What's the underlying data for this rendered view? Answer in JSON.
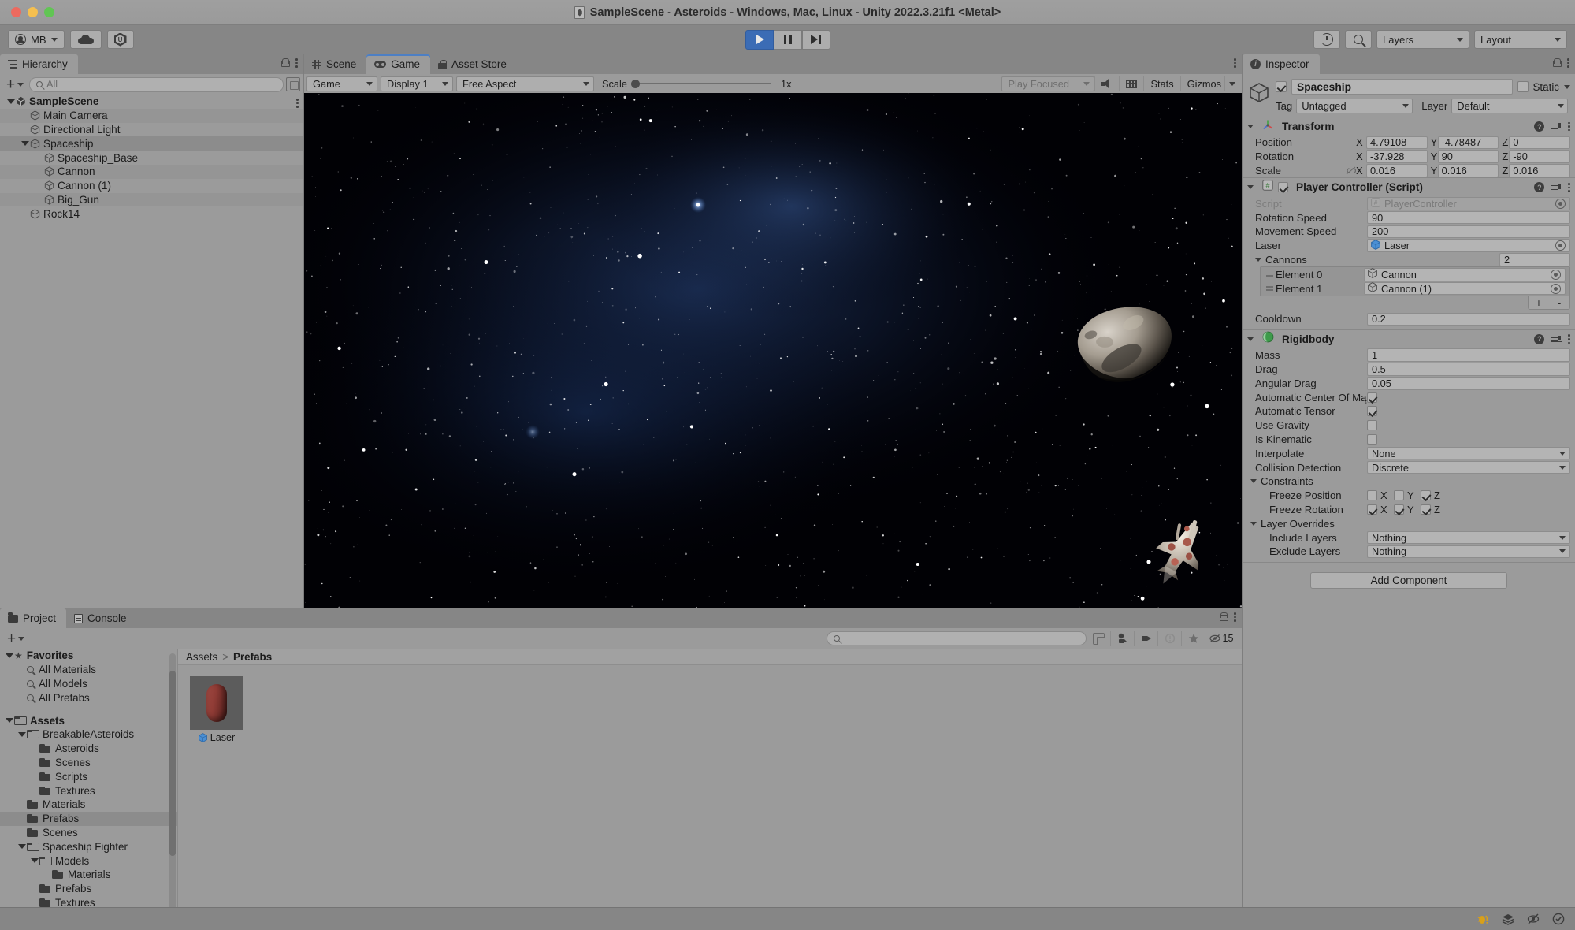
{
  "window": {
    "title": "SampleScene - Asteroids - Windows, Mac, Linux - Unity 2022.3.21f1 <Metal>"
  },
  "toolbar": {
    "account_label": "MB",
    "cloud_icon": "cloud-icon",
    "services_icon": "unity-services-icon",
    "play_icon": "play-icon",
    "pause_icon": "pause-icon",
    "step_icon": "step-icon",
    "play_active": true,
    "history_icon": "history-icon",
    "search_icon": "search-icon",
    "layers_label": "Layers",
    "layout_label": "Layout"
  },
  "hierarchy": {
    "tab_label": "Hierarchy",
    "add_label": "+",
    "search_placeholder": "All",
    "items": [
      {
        "label": "SampleScene",
        "depth": 0,
        "expanded": true,
        "selected": false,
        "bold": true,
        "icon": "unity-scene-icon"
      },
      {
        "label": "Main Camera",
        "depth": 1,
        "expanded": null,
        "selected": false,
        "bold": false,
        "icon": "gameobject-icon"
      },
      {
        "label": "Directional Light",
        "depth": 1,
        "expanded": null,
        "selected": false,
        "bold": false,
        "icon": "gameobject-icon"
      },
      {
        "label": "Spaceship",
        "depth": 1,
        "expanded": true,
        "selected": true,
        "bold": false,
        "icon": "gameobject-icon"
      },
      {
        "label": "Spaceship_Base",
        "depth": 2,
        "expanded": null,
        "selected": false,
        "bold": false,
        "icon": "gameobject-icon"
      },
      {
        "label": "Cannon",
        "depth": 2,
        "expanded": null,
        "selected": false,
        "bold": false,
        "icon": "gameobject-icon"
      },
      {
        "label": "Cannon (1)",
        "depth": 2,
        "expanded": null,
        "selected": false,
        "bold": false,
        "icon": "gameobject-icon"
      },
      {
        "label": "Big_Gun",
        "depth": 2,
        "expanded": null,
        "selected": false,
        "bold": false,
        "icon": "gameobject-icon"
      },
      {
        "label": "Rock14",
        "depth": 1,
        "expanded": null,
        "selected": false,
        "bold": false,
        "icon": "gameobject-icon"
      }
    ]
  },
  "center_tabs": [
    {
      "label": "Scene",
      "icon": "scene-icon",
      "selected": false
    },
    {
      "label": "Game",
      "icon": "game-icon",
      "selected": true
    },
    {
      "label": "Asset Store",
      "icon": "asset-store-icon",
      "selected": false
    }
  ],
  "gameview": {
    "view_select": "Game",
    "display_select": "Display 1",
    "aspect_select": "Free Aspect",
    "scale_label": "Scale",
    "scale_value": "1x",
    "play_focus_select": "Play Focused",
    "mute_icon": "mute-audio-icon",
    "stats_icon": "frame-debug-icon",
    "stats_label": "Stats",
    "gizmos_label": "Gizmos"
  },
  "inspector": {
    "tab_label": "Inspector",
    "object_name": "Spaceship",
    "enabled": true,
    "static_label": "Static",
    "static_checked": false,
    "tag_label": "Tag",
    "tag_value": "Untagged",
    "layer_label": "Layer",
    "layer_value": "Default",
    "transform": {
      "title": "Transform",
      "rows": [
        {
          "label": "Position",
          "x": "4.79108",
          "y": "-4.78487",
          "z": "0"
        },
        {
          "label": "Rotation",
          "x": "-37.928",
          "y": "90",
          "z": "-90"
        },
        {
          "label": "Scale",
          "x": "0.016",
          "y": "0.016",
          "z": "0.016"
        }
      ]
    },
    "player_controller": {
      "title": "Player Controller (Script)",
      "enabled": true,
      "script_label": "Script",
      "script_value": "PlayerController",
      "rotation_speed_label": "Rotation Speed",
      "rotation_speed_value": "90",
      "movement_speed_label": "Movement Speed",
      "movement_speed_value": "200",
      "laser_label": "Laser",
      "laser_value": "Laser",
      "cannons_label": "Cannons",
      "cannons_count": "2",
      "cannons": [
        {
          "label": "Element 0",
          "value": "Cannon"
        },
        {
          "label": "Element 1",
          "value": "Cannon (1)"
        }
      ],
      "add_btn": "+",
      "remove_btn": "-",
      "cooldown_label": "Cooldown",
      "cooldown_value": "0.2"
    },
    "rigidbody": {
      "title": "Rigidbody",
      "mass_label": "Mass",
      "mass_value": "1",
      "drag_label": "Drag",
      "drag_value": "0.5",
      "angular_drag_label": "Angular Drag",
      "angular_drag_value": "0.05",
      "auto_com_label": "Automatic Center Of Mą",
      "auto_com_checked": true,
      "auto_tensor_label": "Automatic Tensor",
      "auto_tensor_checked": true,
      "use_gravity_label": "Use Gravity",
      "use_gravity_checked": false,
      "is_kinematic_label": "Is Kinematic",
      "is_kinematic_checked": false,
      "interpolate_label": "Interpolate",
      "interpolate_value": "None",
      "collision_label": "Collision Detection",
      "collision_value": "Discrete",
      "constraints_label": "Constraints",
      "freeze_position_label": "Freeze Position",
      "freeze_position": {
        "x": false,
        "y": false,
        "z": true
      },
      "freeze_rotation_label": "Freeze Rotation",
      "freeze_rotation": {
        "x": true,
        "y": true,
        "z": true
      },
      "layer_overrides_label": "Layer Overrides",
      "include_layers_label": "Include Layers",
      "include_layers_value": "Nothing",
      "exclude_layers_label": "Exclude Layers",
      "exclude_layers_value": "Nothing"
    },
    "add_component_label": "Add Component",
    "axis_x": "X",
    "axis_y": "Y",
    "axis_z": "Z"
  },
  "project": {
    "tabs": [
      {
        "label": "Project",
        "icon": "folder-icon",
        "selected": true
      },
      {
        "label": "Console",
        "icon": "console-icon",
        "selected": false
      }
    ],
    "add_label": "+",
    "search_placeholder": "",
    "hidden_count": "15",
    "tree": [
      {
        "label": "Favorites",
        "depth": 0,
        "kind": "star",
        "expanded": true,
        "bold": true,
        "selected": false
      },
      {
        "label": "All Materials",
        "depth": 1,
        "kind": "search",
        "expanded": null,
        "bold": false,
        "selected": false
      },
      {
        "label": "All Models",
        "depth": 1,
        "kind": "search",
        "expanded": null,
        "bold": false,
        "selected": false
      },
      {
        "label": "All Prefabs",
        "depth": 1,
        "kind": "search",
        "expanded": null,
        "bold": false,
        "selected": false
      },
      {
        "label": "",
        "depth": 0,
        "kind": "spacer",
        "expanded": null,
        "bold": false,
        "selected": false
      },
      {
        "label": "Assets",
        "depth": 0,
        "kind": "folder-open",
        "expanded": true,
        "bold": true,
        "selected": false
      },
      {
        "label": "BreakableAsteroids",
        "depth": 1,
        "kind": "folder-open",
        "expanded": true,
        "bold": false,
        "selected": false
      },
      {
        "label": "Asteroids",
        "depth": 2,
        "kind": "folder",
        "expanded": null,
        "bold": false,
        "selected": false
      },
      {
        "label": "Scenes",
        "depth": 2,
        "kind": "folder",
        "expanded": null,
        "bold": false,
        "selected": false
      },
      {
        "label": "Scripts",
        "depth": 2,
        "kind": "folder",
        "expanded": null,
        "bold": false,
        "selected": false
      },
      {
        "label": "Textures",
        "depth": 2,
        "kind": "folder",
        "expanded": null,
        "bold": false,
        "selected": false
      },
      {
        "label": "Materials",
        "depth": 1,
        "kind": "folder",
        "expanded": null,
        "bold": false,
        "selected": false
      },
      {
        "label": "Prefabs",
        "depth": 1,
        "kind": "folder",
        "expanded": null,
        "bold": false,
        "selected": true
      },
      {
        "label": "Scenes",
        "depth": 1,
        "kind": "folder",
        "expanded": null,
        "bold": false,
        "selected": false
      },
      {
        "label": "Spaceship Fighter",
        "depth": 1,
        "kind": "folder-open",
        "expanded": true,
        "bold": false,
        "selected": false
      },
      {
        "label": "Models",
        "depth": 2,
        "kind": "folder-open",
        "expanded": true,
        "bold": false,
        "selected": false
      },
      {
        "label": "Materials",
        "depth": 3,
        "kind": "folder",
        "expanded": null,
        "bold": false,
        "selected": false
      },
      {
        "label": "Prefabs",
        "depth": 2,
        "kind": "folder",
        "expanded": null,
        "bold": false,
        "selected": false
      },
      {
        "label": "Textures",
        "depth": 2,
        "kind": "folder",
        "expanded": null,
        "bold": false,
        "selected": false
      }
    ],
    "breadcrumbs": [
      "Assets",
      "Prefabs"
    ],
    "assets": [
      {
        "name": "Laser",
        "type": "prefab"
      }
    ]
  },
  "statusbar": {
    "icons": [
      "bug-warning-icon",
      "layers-stack-icon",
      "no-collab-icon",
      "check-circle-icon"
    ]
  },
  "colors": {
    "accent_blue": "#3b6cb5",
    "panel_bg": "#9b9b9b",
    "toolbar_bg": "#868686",
    "selected_row": "#8c8c8c"
  }
}
